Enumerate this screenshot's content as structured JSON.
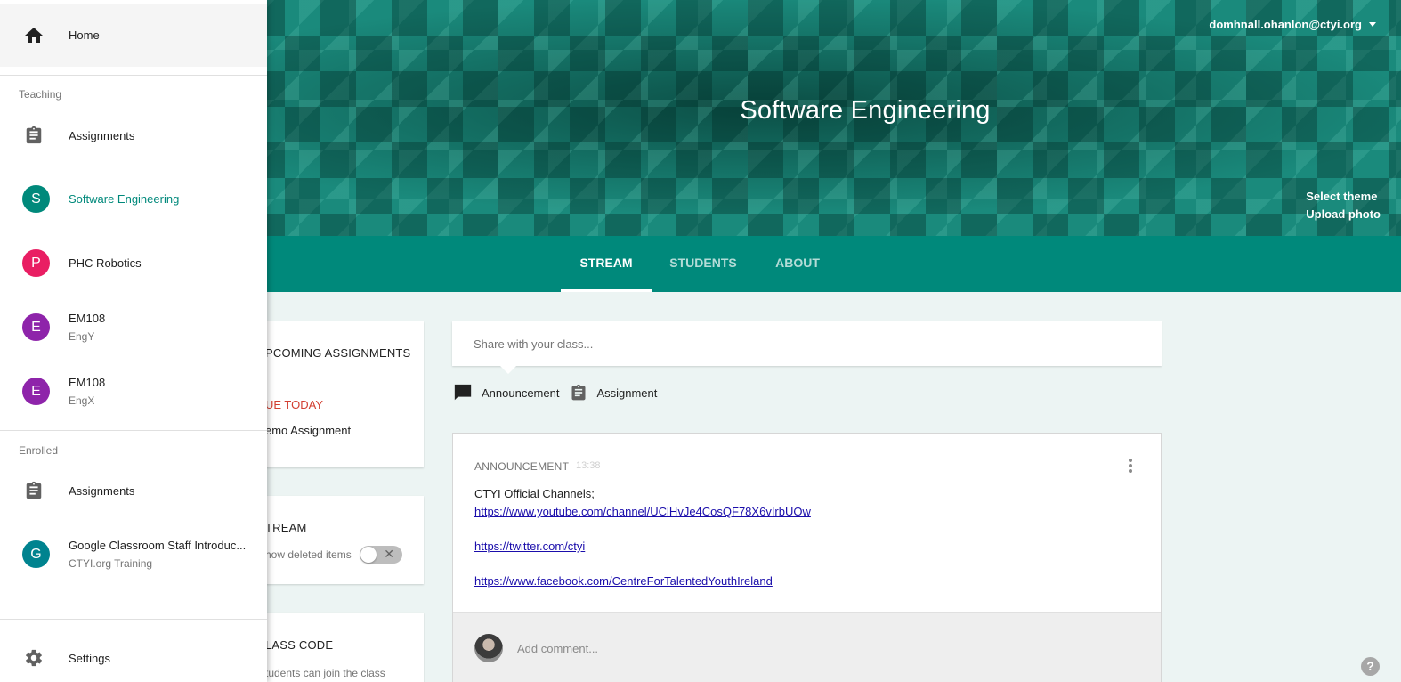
{
  "header": {
    "class_title": "Software Engineering",
    "account_email": "domhnall.ohanlon@ctyi.org",
    "select_theme": "Select theme",
    "upload_photo": "Upload photo",
    "tabs": [
      {
        "label": "STREAM",
        "active": true
      },
      {
        "label": "STUDENTS",
        "active": false
      },
      {
        "label": "ABOUT",
        "active": false
      }
    ]
  },
  "drawer": {
    "home_label": "Home",
    "teaching_label": "Teaching",
    "enrolled_label": "Enrolled",
    "teaching_items": [
      {
        "label": "Assignments",
        "icon": "clipboard-icon"
      },
      {
        "label": "Software Engineering",
        "letter": "S",
        "color": "#00897b",
        "selected": true
      },
      {
        "label": "PHC Robotics",
        "letter": "P",
        "color": "#e91e63"
      },
      {
        "label": "EM108",
        "sub": "EngY",
        "letter": "E",
        "color": "#8e24aa"
      },
      {
        "label": "EM108",
        "sub": "EngX",
        "letter": "E",
        "color": "#8e24aa"
      }
    ],
    "enrolled_items": [
      {
        "label": "Assignments",
        "icon": "clipboard-icon"
      },
      {
        "label": "Google Classroom Staff Introduc...",
        "sub": "CTYI.org Training",
        "letter": "G",
        "color": "#00838f"
      }
    ],
    "settings_label": "Settings"
  },
  "side_cards": {
    "upcoming_title": "UPCOMING ASSIGNMENTS",
    "upcoming_title_visible": "PCOMING ASSIGNMENTS",
    "due_today": "UE TODAY",
    "demo_assignment": "emo Assignment",
    "stream_title": "TREAM",
    "show_deleted": "how deleted items",
    "class_code_title": "LASS CODE",
    "class_code_desc": "tudents can join the class"
  },
  "share": {
    "placeholder": "Share with your class...",
    "announcement_label": "Announcement",
    "assignment_label": "Assignment"
  },
  "post": {
    "type_label": "ANNOUNCEMENT",
    "time": "13:38",
    "line1": "CTYI Official Channels;",
    "link1": "https://www.youtube.com/channel/UClHvJe4CosQF78X6vIrbUOw",
    "link2": "https://twitter.com/ctyi",
    "link3": "https://www.facebook.com/CentreForTalentedYouthIreland",
    "comment_placeholder": "Add comment..."
  },
  "help_label": "?",
  "colors": {
    "primary": "#00897b",
    "due_red": "#d23f31",
    "link": "#1a0dab"
  }
}
